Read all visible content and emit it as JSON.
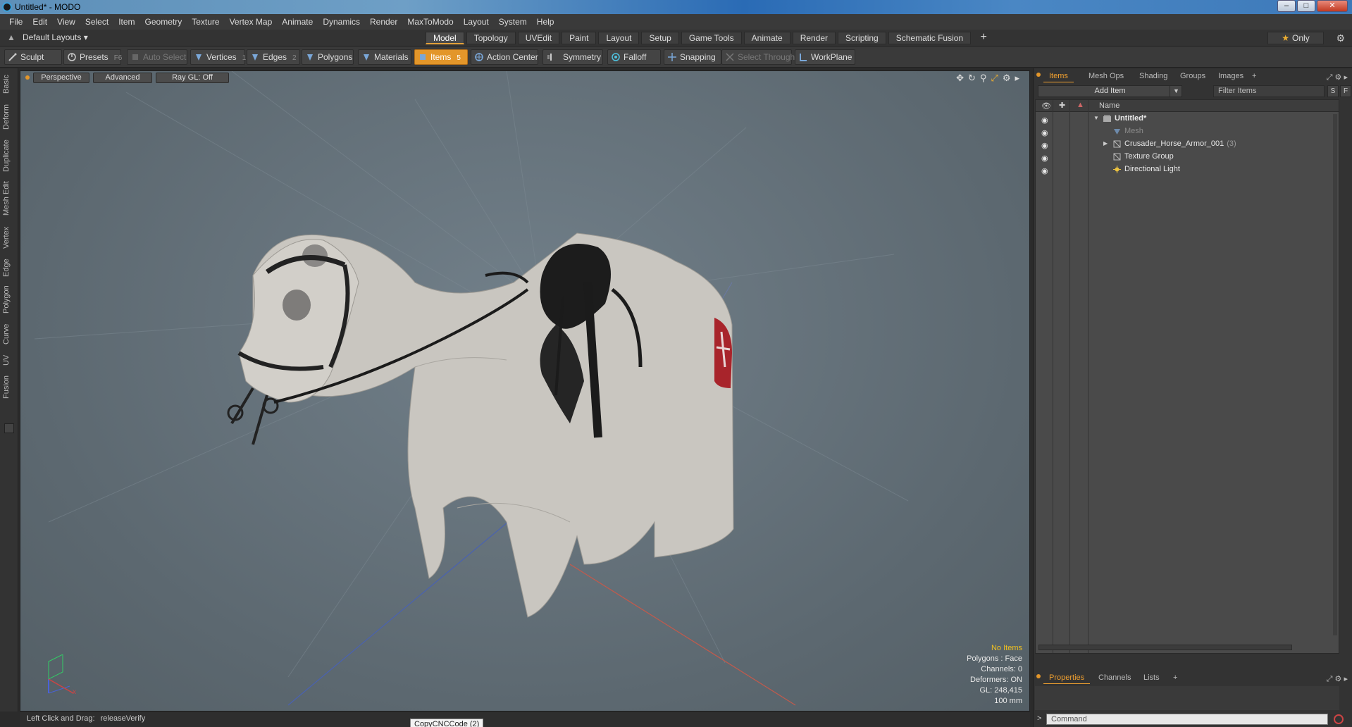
{
  "window": {
    "title": "Untitled* - MODO"
  },
  "menu": [
    "File",
    "Edit",
    "View",
    "Select",
    "Item",
    "Geometry",
    "Texture",
    "Vertex Map",
    "Animate",
    "Dynamics",
    "Render",
    "MaxToModo",
    "Layout",
    "System",
    "Help"
  ],
  "layoutbar": {
    "layout_label": "Default Layouts",
    "tabs": [
      "Model",
      "Topology",
      "UVEdit",
      "Paint",
      "Layout",
      "Setup",
      "Game Tools",
      "Animate",
      "Render",
      "Scripting",
      "Schematic Fusion"
    ],
    "active_tab": "Model",
    "add": "+",
    "only_label": "Only"
  },
  "toolbar": {
    "sculpt": "Sculpt",
    "presets": "Presets",
    "presets_key": "F6",
    "auto_select": "Auto Select",
    "vertices": "Vertices",
    "vertices_key": "1",
    "edges": "Edges",
    "edges_key": "2",
    "polygons": "Polygons",
    "materials": "Materials",
    "items": "Items",
    "items_key": "5",
    "action_center": "Action Center",
    "symmetry": "Symmetry",
    "falloff": "Falloff",
    "snapping": "Snapping",
    "select_through": "Select Through",
    "workplane": "WorkPlane"
  },
  "left_tabs": [
    "Basic",
    "Deform",
    "Duplicate",
    "Mesh Edit",
    "Vertex",
    "Edge",
    "Polygon",
    "Curve",
    "UV",
    "Fusion"
  ],
  "viewport": {
    "view": "Perspective",
    "shading": "Advanced",
    "raygl": "Ray GL: Off",
    "info": {
      "no_items": "No Items",
      "polygons": "Polygons : Face",
      "channels": "Channels: 0",
      "deformers": "Deformers: ON",
      "gl": "GL: 248,415",
      "scale": "100 mm"
    }
  },
  "statusbar": {
    "label": "Left Click and Drag:",
    "value": "releaseVerify"
  },
  "tooltip": "CopyCNCCode (2)",
  "right_panel": {
    "tabs": [
      "Items",
      "Mesh Ops",
      "Shading",
      "Groups",
      "Images",
      "+"
    ],
    "active_tab": "Items",
    "add_item": "Add Item",
    "filter_placeholder": "Filter Items",
    "s_btn": "S",
    "f_btn": "F",
    "col_name": "Name",
    "tree": [
      {
        "label": "Untitled*",
        "bold": true
      },
      {
        "label": "Mesh",
        "dim": true
      },
      {
        "label": "Crusader_Horse_Armor_001",
        "count": "(3)"
      },
      {
        "label": "Texture Group"
      },
      {
        "label": "Directional Light"
      }
    ],
    "prop_tabs": [
      "Properties",
      "Channels",
      "Lists",
      "+"
    ],
    "command_placeholder": "Command"
  },
  "colors": {
    "accent": "#e3962a",
    "viewport_bg": "#65727a",
    "warn_text": "#f0c020"
  }
}
